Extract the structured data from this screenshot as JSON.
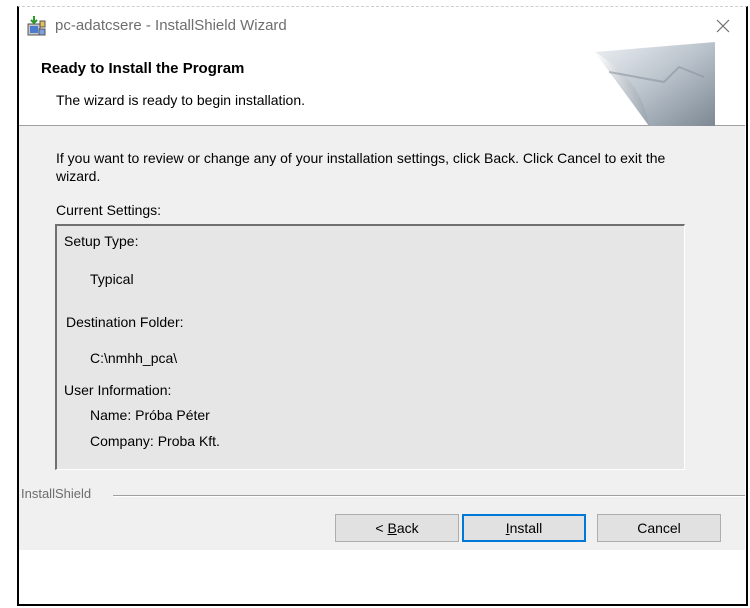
{
  "window": {
    "title": "pc-adatcsere - InstallShield Wizard"
  },
  "header": {
    "title": "Ready to Install the Program",
    "subtitle": "The wizard is ready to begin installation."
  },
  "body": {
    "instructions": "If you want to review or change any of your installation settings, click Back. Click Cancel to exit the wizard.",
    "current_settings_label": "Current Settings:"
  },
  "settings": {
    "setup_type_label": "Setup Type:",
    "setup_type_value": "Typical",
    "destination_label": "Destination Folder:",
    "destination_value": "C:\\nmhh_pca\\",
    "user_info_label": "User Information:",
    "name_line": "Name: Próba Péter",
    "company_line": "Company: Proba Kft."
  },
  "footer": {
    "brand": "InstallShield"
  },
  "buttons": {
    "back_prefix": "< ",
    "back_mnemonic": "B",
    "back_rest": "ack",
    "install_mnemonic": "I",
    "install_rest": "nstall",
    "cancel": "Cancel"
  },
  "icons": {
    "app": "installer-icon",
    "close": "close-icon",
    "header_graphic": "curled-page-graphic"
  },
  "colors": {
    "dialog_bg": "#f0f0f0",
    "default_button_border": "#0078d7",
    "settings_box_bg": "#e6e6e6"
  }
}
